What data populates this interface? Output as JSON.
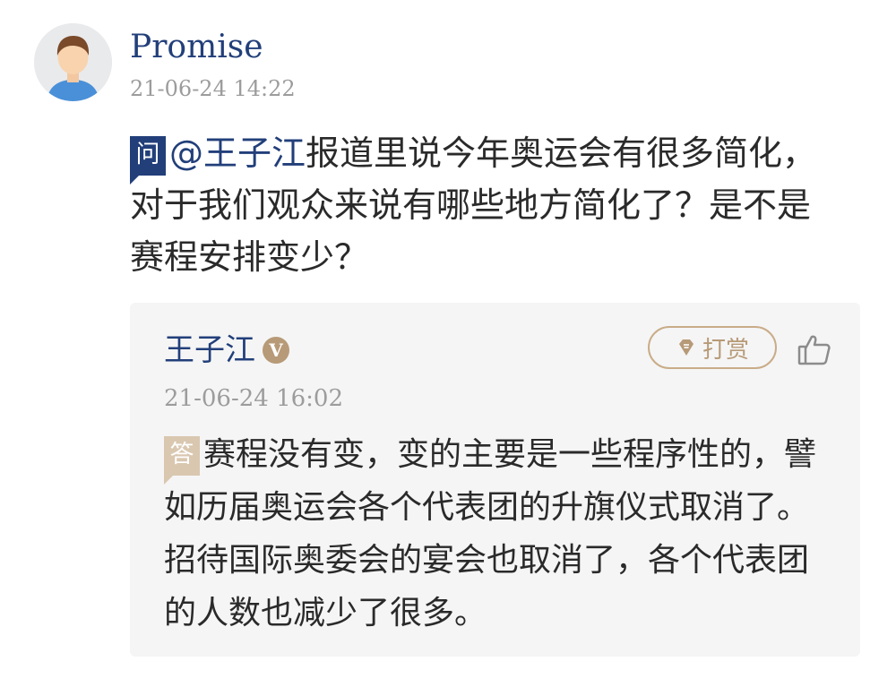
{
  "question": {
    "author": "Promise",
    "time": "21-06-24 14:22",
    "badge": "问",
    "mention": "@王子江",
    "text": "报道里说今年奥运会有很多简化，对于我们观众来说有哪些地方简化了？是不是赛程安排变少？"
  },
  "answer": {
    "author": "王子江",
    "verified_mark": "V",
    "tip_label": "打赏",
    "time": "21-06-24 16:02",
    "badge": "答",
    "text": "赛程没有变，变的主要是一些程序性的，譬如历届奥运会各个代表团的升旗仪式取消了。招待国际奥委会的宴会也取消了，各个代表团的人数也减少了很多。"
  },
  "icons": {
    "avatar": "avatar-icon",
    "tip": "tip-gem-icon",
    "like": "thumbs-up-icon"
  },
  "colors": {
    "brand_blue": "#223f7a",
    "gold": "#b79a77",
    "card_bg": "#f5f5f5",
    "meta_gray": "#9c9c9c"
  }
}
